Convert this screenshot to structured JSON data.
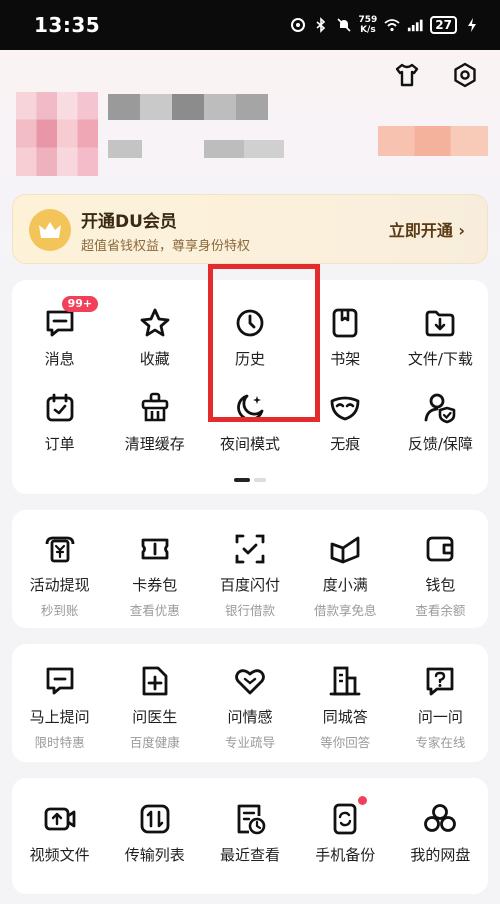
{
  "status_bar": {
    "time": "13:35",
    "net_speed_value": "759",
    "net_speed_unit": "K/s",
    "battery": "27"
  },
  "header": {
    "icons": [
      "tshirt-icon",
      "settings-hex-icon"
    ]
  },
  "vip": {
    "title": "开通DU会员",
    "subtitle": "超值省钱权益，尊享身份特权",
    "button": "立即开通 ›"
  },
  "grid_main": {
    "items": [
      {
        "label": "消息",
        "icon": "message-icon",
        "badge": "99+"
      },
      {
        "label": "收藏",
        "icon": "star-icon"
      },
      {
        "label": "历史",
        "icon": "clock-icon"
      },
      {
        "label": "书架",
        "icon": "bookshelf-icon"
      },
      {
        "label": "文件/下载",
        "icon": "download-icon"
      },
      {
        "label": "订单",
        "icon": "order-icon"
      },
      {
        "label": "清理缓存",
        "icon": "clean-cache-icon"
      },
      {
        "label": "夜间模式",
        "icon": "moon-icon"
      },
      {
        "label": "无痕",
        "icon": "mask-icon"
      },
      {
        "label": "反馈/保障",
        "icon": "feedback-shield-icon"
      }
    ]
  },
  "grid_finance": {
    "items": [
      {
        "label": "活动提现",
        "sub": "秒到账",
        "icon": "cash-withdraw-icon"
      },
      {
        "label": "卡券包",
        "sub": "查看优惠",
        "icon": "coupon-icon"
      },
      {
        "label": "百度闪付",
        "sub": "银行借款",
        "icon": "quick-pay-icon"
      },
      {
        "label": "度小满",
        "sub": "借款享免息",
        "icon": "duxiaoman-icon"
      },
      {
        "label": "钱包",
        "sub": "查看余额",
        "icon": "wallet-icon"
      }
    ]
  },
  "grid_service": {
    "items": [
      {
        "label": "马上提问",
        "sub": "限时特惠",
        "icon": "ask-icon"
      },
      {
        "label": "问医生",
        "sub": "百度健康",
        "icon": "doctor-icon"
      },
      {
        "label": "问情感",
        "sub": "专业疏导",
        "icon": "heart-icon"
      },
      {
        "label": "同城答",
        "sub": "等你回答",
        "icon": "city-icon"
      },
      {
        "label": "问一问",
        "sub": "专家在线",
        "icon": "question-icon"
      }
    ]
  },
  "grid_tools": {
    "items": [
      {
        "label": "视频文件",
        "icon": "video-upload-icon"
      },
      {
        "label": "传输列表",
        "icon": "transfer-icon"
      },
      {
        "label": "最近查看",
        "icon": "recent-doc-icon"
      },
      {
        "label": "手机备份",
        "icon": "phone-backup-icon",
        "dot": true
      },
      {
        "label": "我的网盘",
        "icon": "netdisk-icon"
      }
    ]
  },
  "colors": {
    "badge": "#f2405b",
    "highlight_box": "#e32b2b",
    "vip_bg": "#fdf2d8"
  }
}
